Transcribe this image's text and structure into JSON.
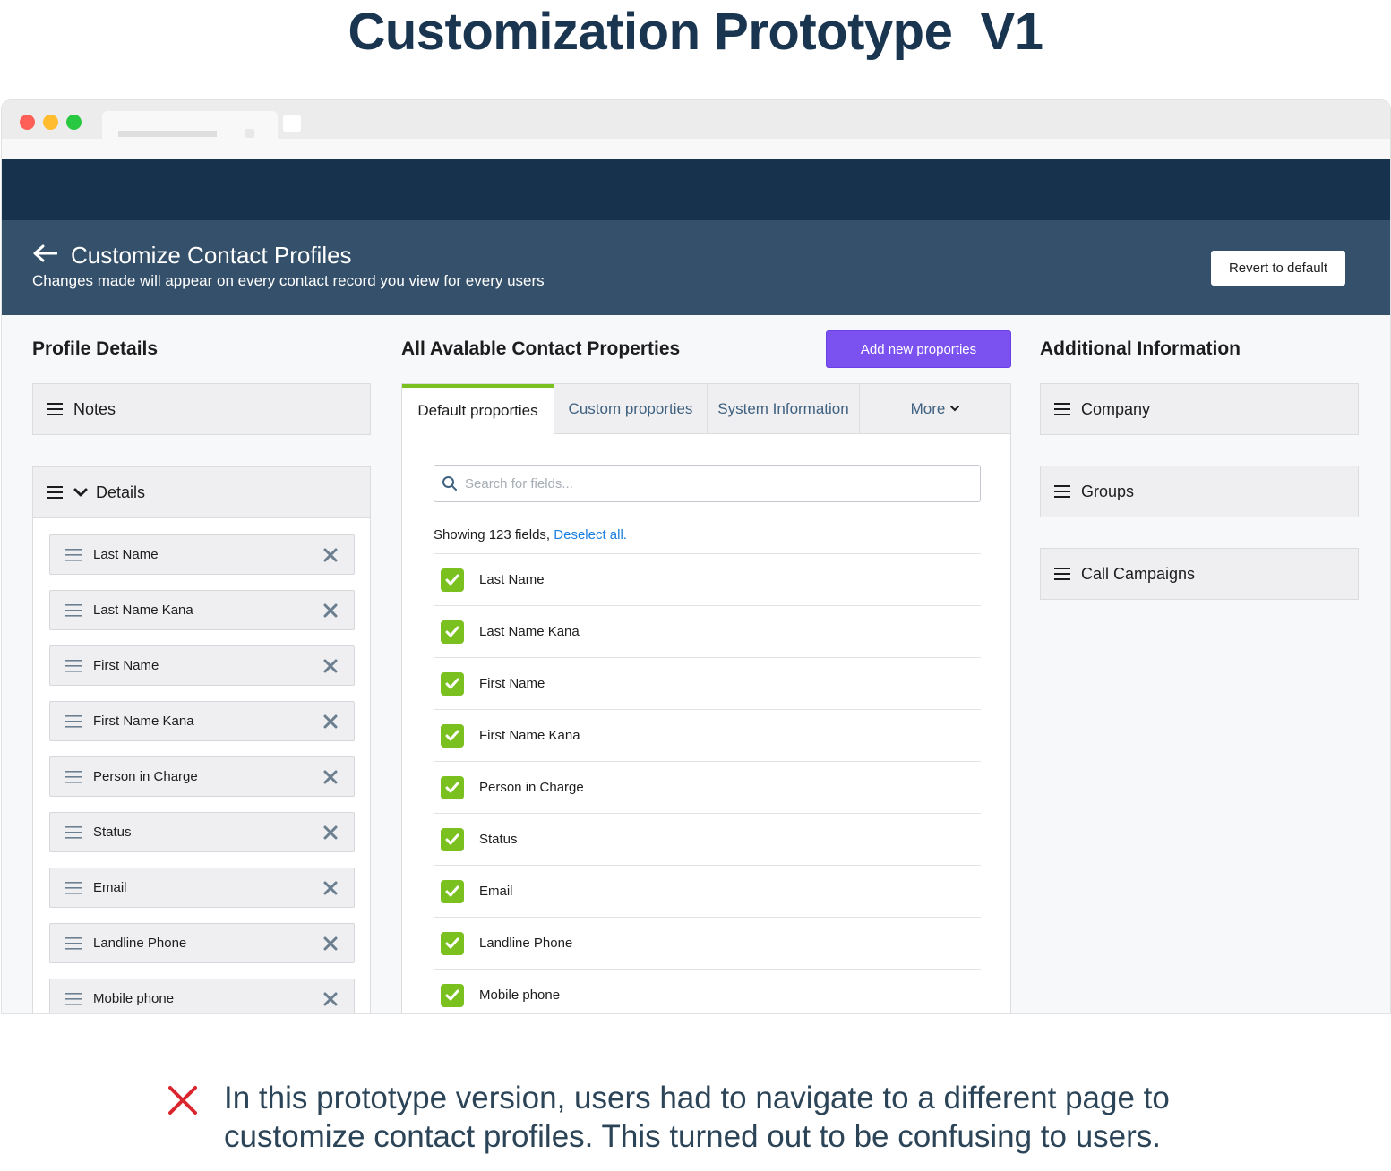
{
  "page_title": "Customization Prototype  V1",
  "header": {
    "title": "Customize Contact Profiles",
    "subtitle": "Changes made will appear on every contact record you view for every users",
    "revert_label": "Revert to default"
  },
  "profile_details": {
    "title": "Profile Details",
    "notes_label": "Notes",
    "details_label": "Details",
    "fields": [
      "Last Name",
      "Last Name Kana",
      "First Name",
      "First Name Kana",
      "Person in Charge",
      "Status",
      "Email",
      "Landline Phone",
      "Mobile phone"
    ]
  },
  "properties": {
    "title": "All Avalable Contact Properties",
    "add_label": "Add new proporties",
    "tabs": [
      "Default proporties",
      "Custom proporties",
      "System Information",
      "More"
    ],
    "search_placeholder": "Search for fields...",
    "showing_text": "Showing 123 fields, ",
    "deselect_label": "Deselect all.",
    "items": [
      "Last Name",
      "Last Name Kana",
      "First Name",
      "First Name Kana",
      "Person in Charge",
      "Status",
      "Email",
      "Landline Phone",
      "Mobile phone"
    ]
  },
  "additional": {
    "title": "Additional Information",
    "items": [
      "Company",
      "Groups",
      "Call Campaigns"
    ]
  },
  "caption": "In this prototype version, users had to navigate to a different page to customize contact profiles. This turned out to be confusing to users.",
  "colors": {
    "topbar": "#17324c",
    "headbar": "#35506a",
    "accent_purple": "#7b52f0",
    "check_green": "#7ac01f",
    "link_blue": "#1a7fe0",
    "caption_x_red": "#d9262e"
  }
}
